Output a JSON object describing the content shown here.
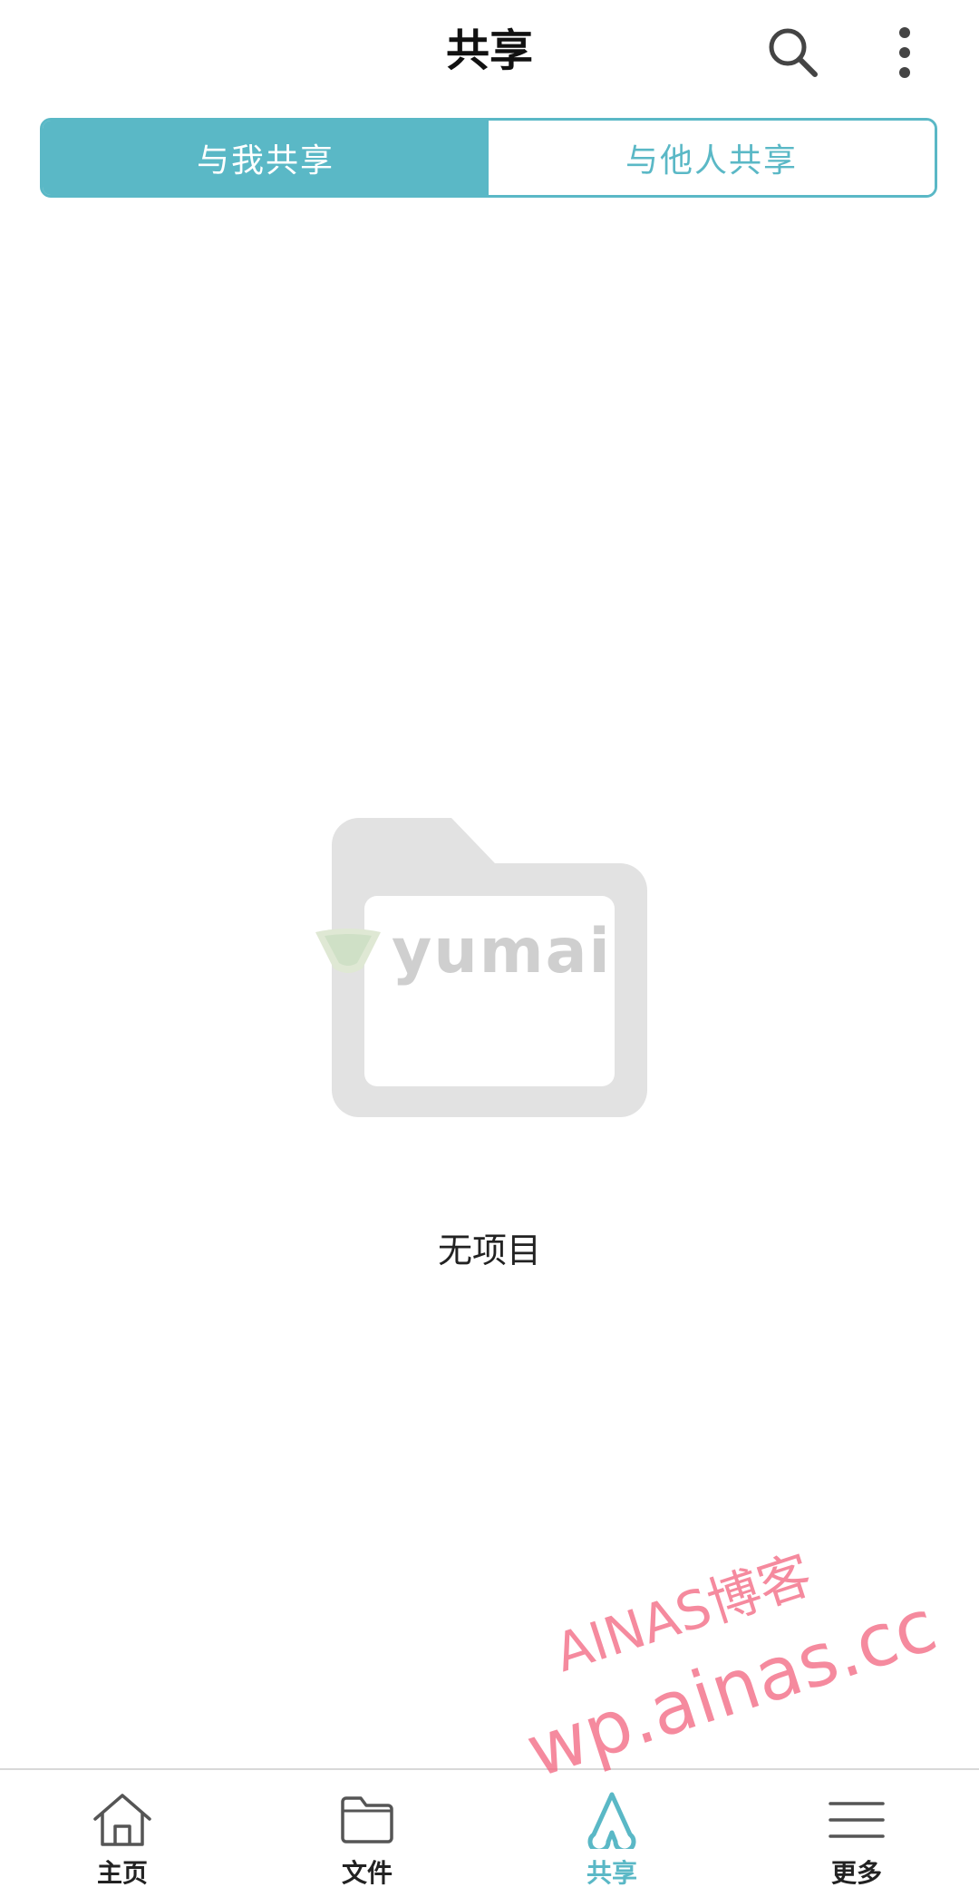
{
  "header": {
    "title": "共享",
    "search_icon": "search-icon",
    "more_icon": "more-vertical-icon"
  },
  "tabs": [
    {
      "label": "与我共享",
      "active": true
    },
    {
      "label": "与他人共享",
      "active": false
    }
  ],
  "empty_state": {
    "icon": "folder-icon",
    "logo_text": "yumai",
    "label": "无项目"
  },
  "bottom_nav": {
    "items": [
      {
        "label": "主页",
        "icon": "home-icon",
        "active": false
      },
      {
        "label": "文件",
        "icon": "folder-icon",
        "active": false
      },
      {
        "label": "共享",
        "icon": "share-icon",
        "active": true
      },
      {
        "label": "更多",
        "icon": "menu-icon",
        "active": false
      }
    ]
  },
  "watermark": {
    "line1": "AINAS博客",
    "line2": "wp.ainas.cc"
  },
  "colors": {
    "accent": "#5ab8c6",
    "watermark": "#f2637e",
    "placeholder_gray": "#e2e2e2"
  }
}
